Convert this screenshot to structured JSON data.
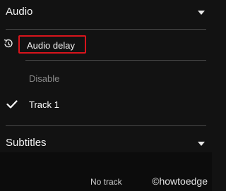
{
  "audio_section": {
    "title": "Audio",
    "delay_label": "Audio delay",
    "tracks": [
      {
        "label": "Disable",
        "selected": false
      },
      {
        "label": "Track 1",
        "selected": true
      }
    ]
  },
  "subtitles_section": {
    "title": "Subtitles",
    "tracks": [
      {
        "label": "No track",
        "selected": false
      }
    ]
  },
  "watermark": "©howtoedge",
  "colors": {
    "background": "#121212",
    "divider": "#4a4a4a",
    "highlight_box": "#d8141c",
    "disabled_text": "#8a8a8a",
    "text": "#ffffff"
  },
  "icons": [
    "caret-down-icon",
    "history-clock-icon",
    "check-icon"
  ]
}
